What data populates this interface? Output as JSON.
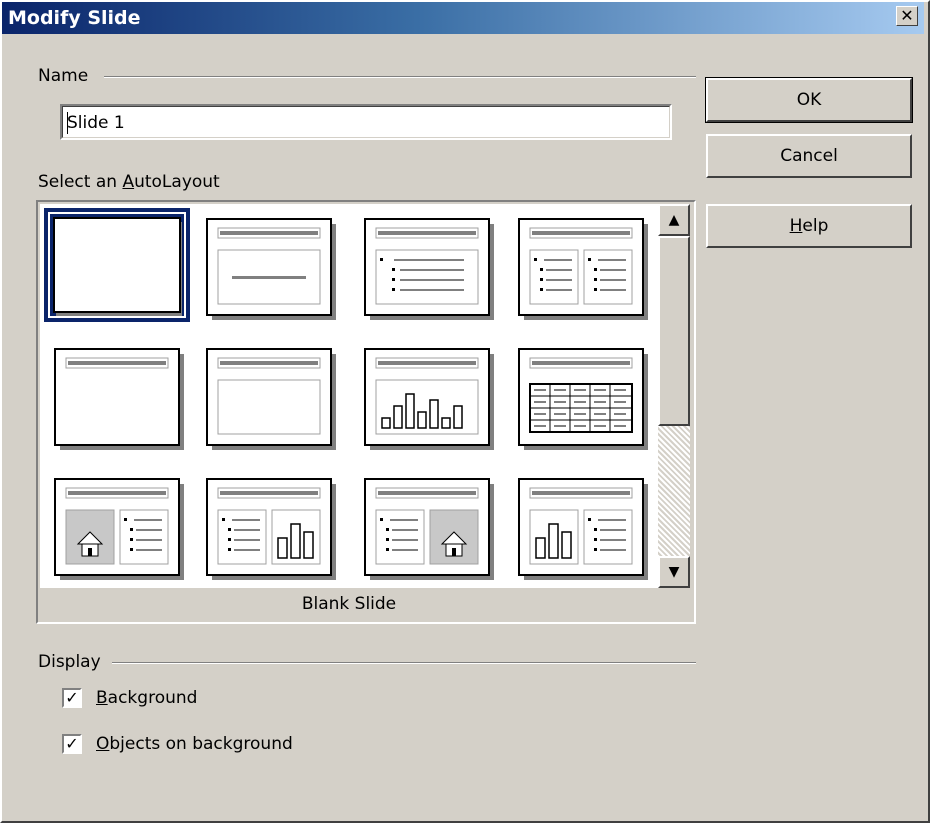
{
  "dialog": {
    "title": "Modify Slide",
    "close_glyph": "✕"
  },
  "name_section": {
    "label": "Name",
    "value": "Slide 1"
  },
  "autolayout": {
    "label_prefix": "Select an ",
    "label_mnemonic": "A",
    "label_rest": "utoLayout",
    "selected": "Blank Slide",
    "layouts": [
      {
        "kind": "blank"
      },
      {
        "kind": "title-only-centered"
      },
      {
        "kind": "title-bullets"
      },
      {
        "kind": "title-2-bullets"
      },
      {
        "kind": "title-only"
      },
      {
        "kind": "title-content"
      },
      {
        "kind": "title-chart"
      },
      {
        "kind": "title-table"
      },
      {
        "kind": "title-image-bullets"
      },
      {
        "kind": "title-bullets-chart"
      },
      {
        "kind": "title-bullets-image"
      },
      {
        "kind": "title-chart-bullets"
      }
    ]
  },
  "buttons": {
    "ok": "OK",
    "cancel": "Cancel",
    "help_mnemonic": "H",
    "help_rest": "elp"
  },
  "display": {
    "label": "Display",
    "background": {
      "mnemonic": "B",
      "rest": "ackground",
      "checked": true
    },
    "objects": {
      "mnemonic": "O",
      "rest": "bjects on background",
      "checked": true
    }
  },
  "scrollbar": {
    "up_glyph": "▲",
    "down_glyph": "▼"
  },
  "check_glyph": "✓"
}
